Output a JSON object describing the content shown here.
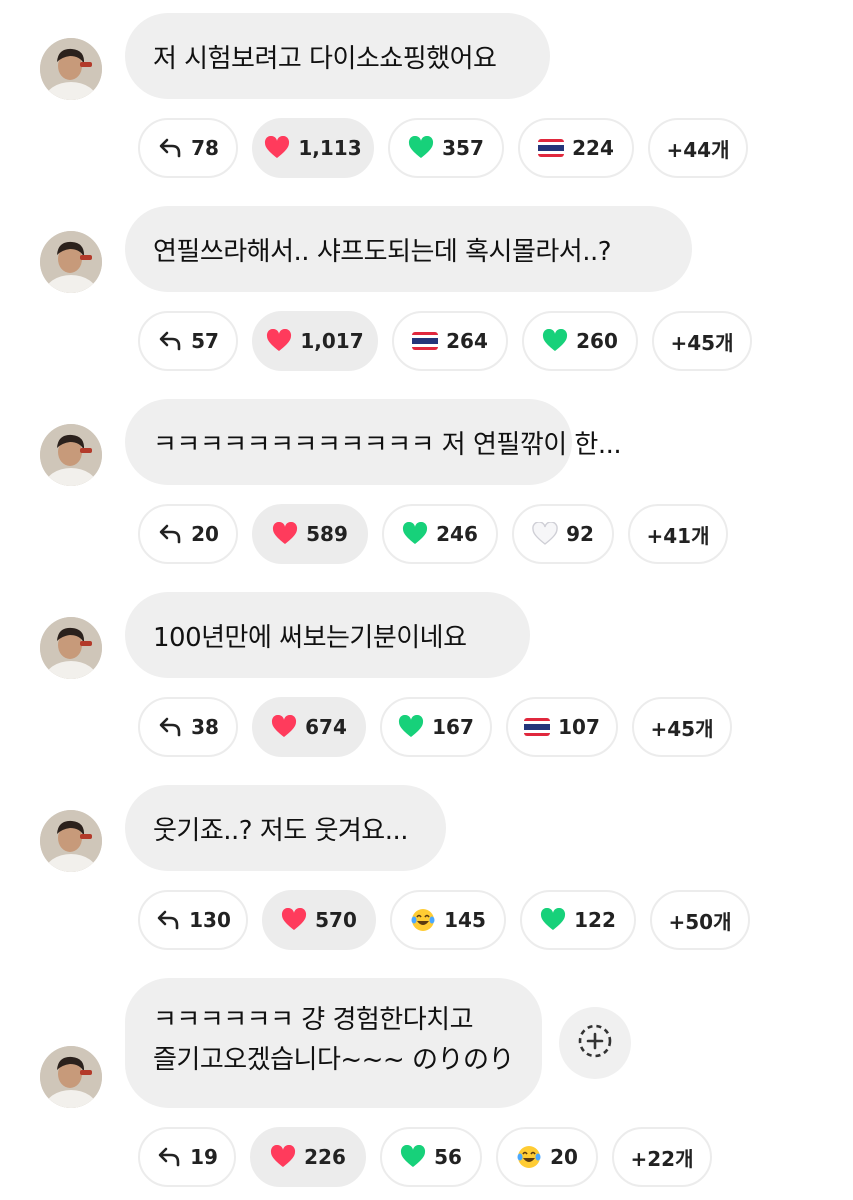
{
  "comments": [
    {
      "text": "저 시험보려고 다이소쇼핑했어요",
      "reply_count": "78",
      "reactions": [
        {
          "icon": "heart-red",
          "count": "1,113"
        },
        {
          "icon": "heart-green",
          "count": "357"
        },
        {
          "icon": "flag-thailand",
          "count": "224"
        }
      ],
      "more": "+44개"
    },
    {
      "text": "연필쓰라해서.. 샤프도되는데 혹시몰라서..?",
      "reply_count": "57",
      "reactions": [
        {
          "icon": "heart-red",
          "count": "1,017"
        },
        {
          "icon": "flag-thailand",
          "count": "264"
        },
        {
          "icon": "heart-green",
          "count": "260"
        }
      ],
      "more": "+45개"
    },
    {
      "text": "ㅋㅋㅋㅋㅋㅋㅋㅋㅋㅋㅋㅋ 저 연필깎이 한...",
      "reply_count": "20",
      "reactions": [
        {
          "icon": "heart-red",
          "count": "589"
        },
        {
          "icon": "heart-green",
          "count": "246"
        },
        {
          "icon": "heart-white",
          "count": "92"
        }
      ],
      "more": "+41개"
    },
    {
      "text": "100년만에 써보는기분이네요",
      "reply_count": "38",
      "reactions": [
        {
          "icon": "heart-red",
          "count": "674"
        },
        {
          "icon": "heart-green",
          "count": "167"
        },
        {
          "icon": "flag-thailand",
          "count": "107"
        }
      ],
      "more": "+45개"
    },
    {
      "text": "웃기죠..? 저도 웃겨요...",
      "reply_count": "130",
      "reactions": [
        {
          "icon": "heart-red",
          "count": "570"
        },
        {
          "icon": "face-tears-of-joy",
          "count": "145"
        },
        {
          "icon": "heart-green",
          "count": "122"
        }
      ],
      "more": "+50개"
    },
    {
      "lines": [
        "ㅋㅋㅋㅋㅋㅋ 걍 경험한다치고",
        "즐기고오겠습니다~~~ のりのり"
      ],
      "reply_count": "19",
      "reactions": [
        {
          "icon": "heart-red",
          "count": "226"
        },
        {
          "icon": "heart-green",
          "count": "56"
        },
        {
          "icon": "face-tears-of-joy",
          "count": "20"
        }
      ],
      "more": "+22개",
      "add_reaction_icon": "add-reaction-icon"
    }
  ],
  "colors": {
    "bubble_bg": "#efefef",
    "pill_border": "#ececec",
    "heart_red": "#ff3b5c",
    "heart_green": "#17d17a"
  }
}
